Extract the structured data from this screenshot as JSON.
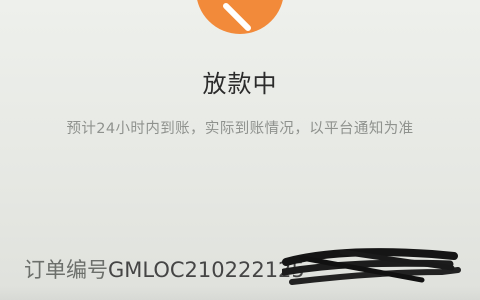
{
  "status": {
    "icon": "loading-clock-icon",
    "accent_color": "#f28a3a",
    "title": "放款中",
    "subtitle": "预计24小时内到账，实际到账情况，以平台通知为准"
  },
  "order": {
    "label": "订单编号",
    "number_visible": "GMLOC210222125"
  }
}
